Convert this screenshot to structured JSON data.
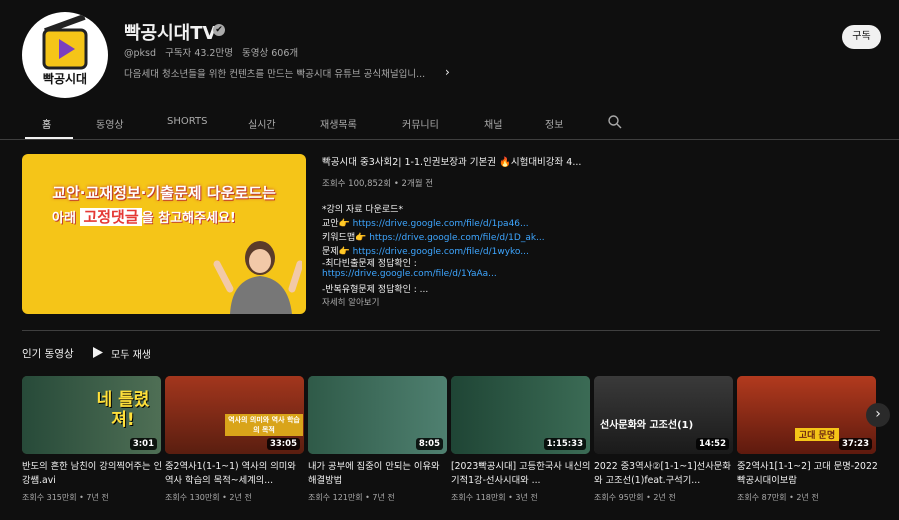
{
  "channel": {
    "logo_text": "빡공시대",
    "name": "빡공시대TV",
    "verified_mark": "✔",
    "handle": "@pksd",
    "subscribers": "구독자 43.2만명",
    "video_count": "동영상 606개",
    "description": "다음세대 청소년들을 위한 컨텐츠를 만드는 빡공시대 유튜브 공식채널입니...",
    "subscribe_label": "구독"
  },
  "tabs": [
    {
      "label": "홈",
      "active": true
    },
    {
      "label": "동영상"
    },
    {
      "label": "SHORTS"
    },
    {
      "label": "실시간"
    },
    {
      "label": "재생목록"
    },
    {
      "label": "커뮤니티"
    },
    {
      "label": "채널"
    },
    {
      "label": "정보"
    }
  ],
  "featured": {
    "thumb_line1": "교안·교재정보·기출문제 다운로드는",
    "thumb_line2a": "아래",
    "thumb_line2b": "고정댓글",
    "thumb_line2c": "을 참고해주세요!",
    "title": "빡공시대 중3사회2| 1-1.인권보장과 기본권 🔥시험대비강좌 4...",
    "meta": "조회수 100,852회 • 2개월 전",
    "lines": [
      {
        "prefix": "*강의 자료 다운로드*",
        "link": ""
      },
      {
        "prefix": "교안👉 ",
        "link": "https://drive.google.com/file/d/1pa46..."
      },
      {
        "prefix": "키워드맵👉 ",
        "link": "https://drive.google.com/file/d/1D_ak..."
      },
      {
        "prefix": "문제👉 ",
        "link": "https://drive.google.com/file/d/1wyko..."
      },
      {
        "prefix": "-최다빈출문제 정답확인 :",
        "link": ""
      },
      {
        "prefix": "",
        "link": "https://drive.google.com/file/d/1YaAa..."
      },
      {
        "prefix": "-반복유형문제 정답확인 : ...",
        "link": ""
      }
    ],
    "read_more": "자세히 알아보기"
  },
  "popular": {
    "title": "인기 동영상",
    "play_all": "모두 재생",
    "videos": [
      {
        "title": "반도의 흔한 남친이 강의찍어주는 인강쌤.avi",
        "meta": "조회수 315만회 • 7년 전",
        "duration": "3:01",
        "thumb_text": "네 틀렸져!",
        "thumb_bg": "#3d5a3c"
      },
      {
        "title": "중2역사1(1-1~1) 역사의 의미와 역사 학습의 목적~세계의...",
        "meta": "조회수 130만회 • 2년 전",
        "duration": "33:05",
        "thumb_text": "역사의 의미와 역사 학습의 목적",
        "thumb_bg": "#7a2d1a"
      },
      {
        "title": "내가 공부에 집중이 안되는 이유와 해결방법",
        "meta": "조회수 121만회 • 7년 전",
        "duration": "8:05",
        "thumb_text": "",
        "thumb_bg": "#3f6e5a"
      },
      {
        "title": "[2023빡공시대] 고등한국사 내신의기적1강-선사시대와 ...",
        "meta": "조회수 118만회 • 3년 전",
        "duration": "1:15:33",
        "thumb_text": "",
        "thumb_bg": "#2f5a48"
      },
      {
        "title": "2022 중3역사②[1-1~1]선사문화와 고조선(1)feat.구석기...",
        "meta": "조회수 95만회 • 2년 전",
        "duration": "14:52",
        "thumb_text": "선사문화와 고조선(1)",
        "thumb_bg": "#2a2a2a"
      },
      {
        "title": "중2역사1[1-1~2] 고대 문명-2022 빡공시대이보람",
        "meta": "조회수 87만회 • 2년 전",
        "duration": "37:23",
        "thumb_text": "고대 문명",
        "thumb_bg": "#8a2a1a"
      }
    ]
  },
  "colors": {
    "accent_link": "#3ea6ff",
    "brand_yellow": "#f5c518"
  }
}
